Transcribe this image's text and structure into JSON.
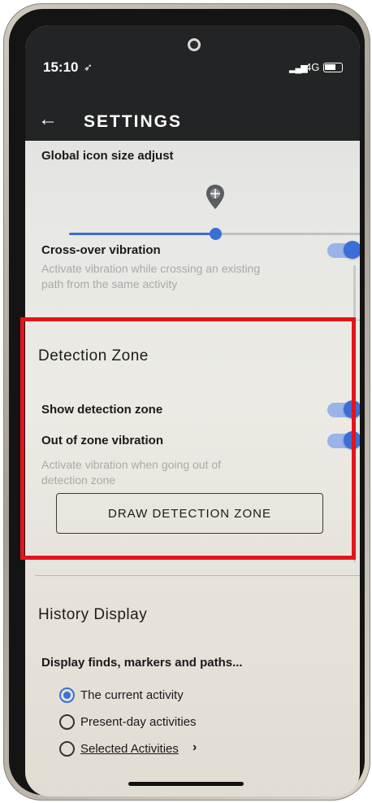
{
  "status_bar": {
    "time": "15:10",
    "location_glyph": "➶",
    "network": "4G",
    "signal_icon": "signal-bars-icon",
    "battery_icon": "battery-icon"
  },
  "toolbar": {
    "back_icon": "←",
    "title": "SETTINGS"
  },
  "icon_size": {
    "label": "Global icon size adjust",
    "slider_value_fraction": 0.5
  },
  "crossover": {
    "label": "Cross-over vibration",
    "description": "Activate vibration while crossing an existing path from the same activity",
    "enabled": true
  },
  "detection_zone": {
    "title": "Detection Zone",
    "show_zone_label": "Show detection zone",
    "show_zone_enabled": true,
    "out_of_zone_label": "Out of zone vibration",
    "out_of_zone_enabled": true,
    "out_of_zone_description": "Activate vibration when going out of detection zone",
    "draw_button": "DRAW DETECTION ZONE"
  },
  "history": {
    "title": "History Display",
    "subtitle": "Display finds, markers and paths...",
    "options": [
      {
        "label": "The current activity",
        "checked": true
      },
      {
        "label": "Present-day activities",
        "checked": false
      },
      {
        "label": "Selected Activities",
        "checked": false
      }
    ],
    "chevron": "›"
  },
  "colors": {
    "accent": "#3b6fd7",
    "highlight_box": "#e3141b",
    "toolbar_bg": "#232425"
  }
}
